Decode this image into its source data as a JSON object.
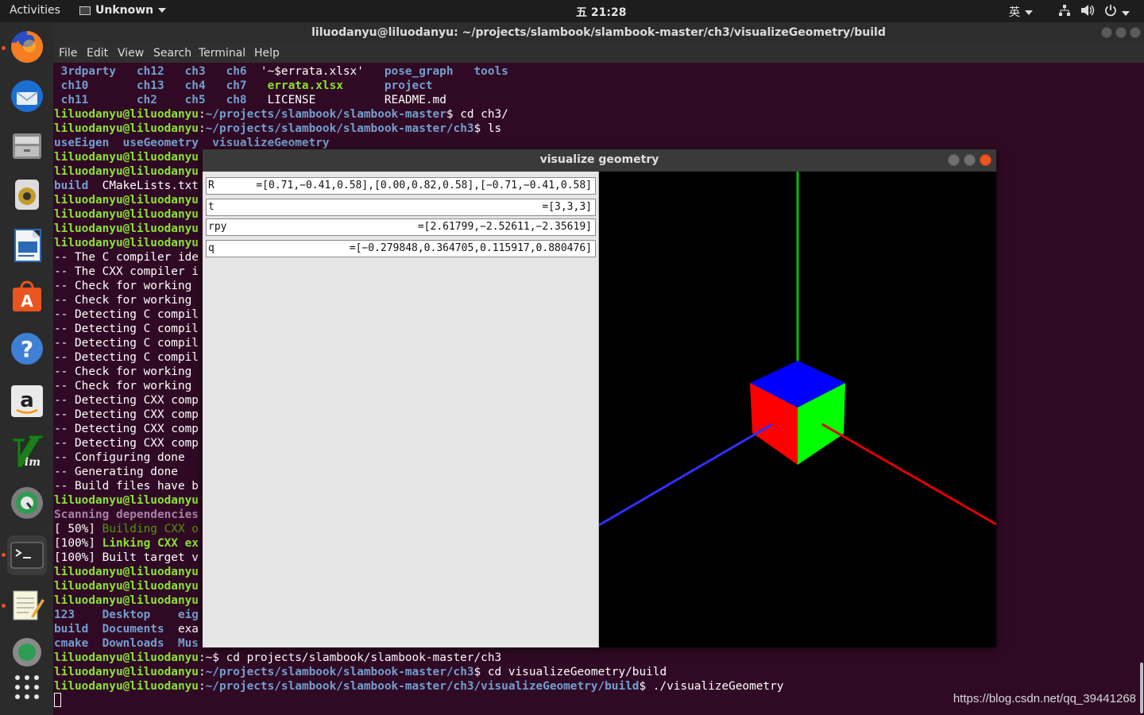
{
  "topbar": {
    "activities": "Activities",
    "app_menu": "Unknown",
    "clock": "五 21:28",
    "input_method": "英"
  },
  "dock": {
    "items": [
      "firefox-icon",
      "thunderbird-icon",
      "files-icon",
      "rhythmbox-icon",
      "libreoffice-writer-icon",
      "software-center-icon",
      "help-icon",
      "amazon-icon",
      "vim-icon",
      "update-manager-icon",
      "terminal-icon",
      "text-editor-icon",
      "settings-icon",
      "show-apps-icon"
    ]
  },
  "terminal": {
    "title": "liluodanyu@liluodanyu: ~/projects/slambook/slambook-master/ch3/visualizeGeometry/build",
    "menu": [
      "File",
      "Edit",
      "View",
      "Search",
      "Terminal",
      "Help"
    ],
    "lines": [
      {
        "segs": [
          {
            "t": " 3rdparty   ch12   ch3   ch6  ",
            "c": "b"
          },
          {
            "t": "'~$errata.xlsx'   ",
            "c": ""
          },
          {
            "t": "pose_graph   tools",
            "c": "b"
          }
        ]
      },
      {
        "segs": [
          {
            "t": " ch10       ch13   ch4   ch7   ",
            "c": "b"
          },
          {
            "t": "errata.xlsx      ",
            "c": "g"
          },
          {
            "t": "project",
            "c": "b"
          }
        ]
      },
      {
        "segs": [
          {
            "t": " ch11       ch2    ch5   ch8   ",
            "c": "b"
          },
          {
            "t": "LICENSE          README.md",
            "c": ""
          }
        ]
      },
      {
        "segs": [
          {
            "t": "liluodanyu@liluodanyu",
            "c": "g"
          },
          {
            "t": ":",
            "c": ""
          },
          {
            "t": "~/projects/slambook/slambook-master",
            "c": "b"
          },
          {
            "t": "$ cd ch3/",
            "c": ""
          }
        ]
      },
      {
        "segs": [
          {
            "t": "liluodanyu@liluodanyu",
            "c": "g"
          },
          {
            "t": ":",
            "c": ""
          },
          {
            "t": "~/projects/slambook/slambook-master/ch3",
            "c": "b"
          },
          {
            "t": "$ ls",
            "c": ""
          }
        ]
      },
      {
        "segs": [
          {
            "t": "useEigen  useGeometry  visualizeGeometry",
            "c": "b"
          }
        ]
      },
      {
        "segs": [
          {
            "t": "liluodanyu@liluodanyu",
            "c": "g"
          }
        ]
      },
      {
        "segs": [
          {
            "t": "liluodanyu@liluodanyu",
            "c": "g"
          }
        ]
      },
      {
        "segs": [
          {
            "t": "build",
            "c": "b"
          },
          {
            "t": "  CMakeLists.txt",
            "c": ""
          }
        ]
      },
      {
        "segs": [
          {
            "t": "liluodanyu@liluodanyu",
            "c": "g"
          }
        ]
      },
      {
        "segs": [
          {
            "t": "liluodanyu@liluodanyu",
            "c": "g"
          }
        ]
      },
      {
        "segs": [
          {
            "t": "liluodanyu@liluodanyu",
            "c": "g"
          }
        ]
      },
      {
        "segs": [
          {
            "t": "liluodanyu@liluodanyu",
            "c": "g"
          }
        ]
      },
      {
        "segs": [
          {
            "t": "-- The C compiler ide",
            "c": ""
          }
        ]
      },
      {
        "segs": [
          {
            "t": "-- The CXX compiler i",
            "c": ""
          }
        ]
      },
      {
        "segs": [
          {
            "t": "-- Check for working ",
            "c": ""
          }
        ]
      },
      {
        "segs": [
          {
            "t": "-- Check for working ",
            "c": ""
          }
        ]
      },
      {
        "segs": [
          {
            "t": "-- Detecting C compil",
            "c": ""
          }
        ]
      },
      {
        "segs": [
          {
            "t": "-- Detecting C compil",
            "c": ""
          }
        ]
      },
      {
        "segs": [
          {
            "t": "-- Detecting C compil",
            "c": ""
          }
        ]
      },
      {
        "segs": [
          {
            "t": "-- Detecting C compil",
            "c": ""
          }
        ]
      },
      {
        "segs": [
          {
            "t": "-- Check for working ",
            "c": ""
          }
        ]
      },
      {
        "segs": [
          {
            "t": "-- Check for working ",
            "c": ""
          }
        ]
      },
      {
        "segs": [
          {
            "t": "-- Detecting CXX comp",
            "c": ""
          }
        ]
      },
      {
        "segs": [
          {
            "t": "-- Detecting CXX comp",
            "c": ""
          }
        ]
      },
      {
        "segs": [
          {
            "t": "-- Detecting CXX comp",
            "c": ""
          }
        ]
      },
      {
        "segs": [
          {
            "t": "-- Detecting CXX comp",
            "c": ""
          }
        ]
      },
      {
        "segs": [
          {
            "t": "-- Configuring done",
            "c": ""
          }
        ]
      },
      {
        "segs": [
          {
            "t": "-- Generating done",
            "c": ""
          }
        ]
      },
      {
        "segs": [
          {
            "t": "-- Build files have b",
            "c": ""
          }
        ]
      },
      {
        "segs": [
          {
            "t": "liluodanyu@liluodanyu",
            "c": "g"
          }
        ]
      },
      {
        "segs": [
          {
            "t": "Scanning dependencies",
            "c": "m"
          }
        ]
      },
      {
        "segs": [
          {
            "t": "[ 50%] ",
            "c": ""
          },
          {
            "t": "Building CXX o",
            "c": "gd"
          }
        ]
      },
      {
        "segs": [
          {
            "t": "[100%] ",
            "c": ""
          },
          {
            "t": "Linking CXX ex",
            "c": "g"
          }
        ]
      },
      {
        "segs": [
          {
            "t": "[100%] Built target v",
            "c": ""
          }
        ]
      },
      {
        "segs": [
          {
            "t": "liluodanyu@liluodanyu",
            "c": "g"
          }
        ]
      },
      {
        "segs": [
          {
            "t": "liluodanyu@liluodanyu",
            "c": "g"
          }
        ]
      },
      {
        "segs": [
          {
            "t": "liluodanyu@liluodanyu",
            "c": "g"
          }
        ]
      },
      {
        "segs": [
          {
            "t": "123    Desktop    eig",
            "c": "b"
          }
        ]
      },
      {
        "segs": [
          {
            "t": "build  Documents  ",
            "c": "b"
          },
          {
            "t": "exa",
            "c": ""
          }
        ]
      },
      {
        "segs": [
          {
            "t": "cmake  Downloads  Mus",
            "c": "b"
          }
        ]
      },
      {
        "segs": [
          {
            "t": "liluodanyu@liluodanyu",
            "c": "g"
          },
          {
            "t": ":~$ cd projects/slambook/slambook-master/ch3",
            "c": ""
          }
        ]
      },
      {
        "segs": [
          {
            "t": "liluodanyu@liluodanyu",
            "c": "g"
          },
          {
            "t": ":",
            "c": ""
          },
          {
            "t": "~/projects/slambook/slambook-master/ch3",
            "c": "b"
          },
          {
            "t": "$ cd visualizeGeometry/build",
            "c": ""
          }
        ]
      },
      {
        "segs": [
          {
            "t": "liluodanyu@liluodanyu",
            "c": "g"
          },
          {
            "t": ":",
            "c": ""
          },
          {
            "t": "~/projects/slambook/slambook-master/ch3/visualizeGeometry/build",
            "c": "b"
          },
          {
            "t": "$ ./visualizeGeometry",
            "c": ""
          }
        ]
      }
    ]
  },
  "geometry_window": {
    "title": "visualize geometry",
    "fields": [
      {
        "label": "R",
        "value": "=[0.71,−0.41,0.58],[0.00,0.82,0.58],[−0.71,−0.41,0.58]"
      },
      {
        "label": "t",
        "value": "=[3,3,3]"
      },
      {
        "label": "rpy",
        "value": "=[2.61799,−2.52611,−2.35619]"
      },
      {
        "label": "q",
        "value": "=[−0.279848,0.364705,0.115917,0.880476]"
      }
    ],
    "axis_colors": {
      "x": "#e00000",
      "y": "#00c000",
      "z": "#3030ff"
    },
    "cube_colors": {
      "top": "#0000ff",
      "left": "#ff0000",
      "right": "#00ff00"
    }
  },
  "watermark": "https://blog.csdn.net/qq_39441268"
}
